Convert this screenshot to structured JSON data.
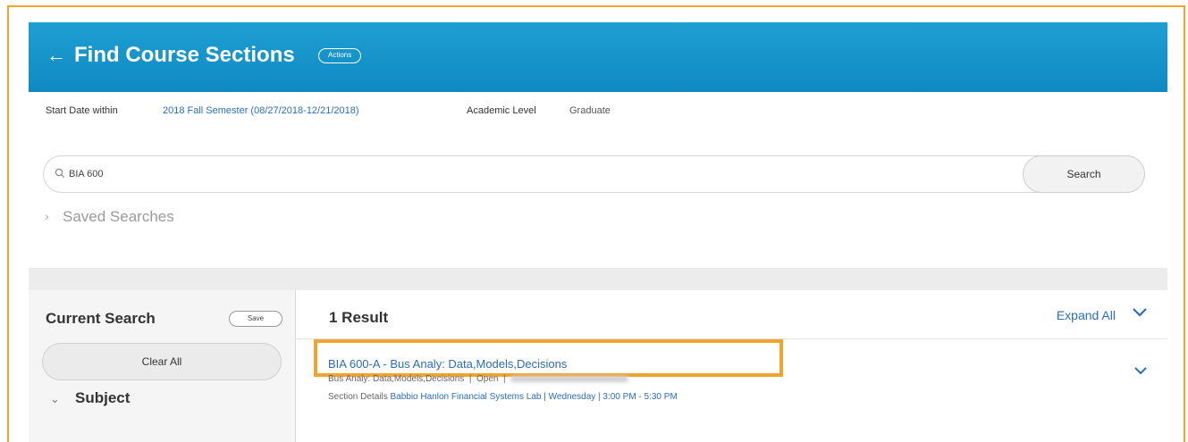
{
  "header": {
    "back_icon": "back-arrow-icon",
    "title": "Find Course Sections",
    "actions_label": "Actions"
  },
  "filters": {
    "start_date_label": "Start Date within",
    "start_date_value": "2018 Fall Semester (08/27/2018-12/21/2018)",
    "academic_level_label": "Academic Level",
    "academic_level_value": "Graduate"
  },
  "search": {
    "query": "BIA 600",
    "button_label": "Search",
    "saved_searches_label": "Saved Searches"
  },
  "sidebar": {
    "current_search_label": "Current Search",
    "save_label": "Save",
    "clear_all_label": "Clear All",
    "subject_label": "Subject"
  },
  "results": {
    "count_label": "1 Result",
    "expand_all_label": "Expand All",
    "items": [
      {
        "title": "BIA 600-A - Bus Analy: Data,Models,Decisions",
        "course_name": "Bus Analy: Data,Models,Decisions",
        "status": "Open",
        "details_label": "Section Details",
        "details_value": "Babbio Hanlon Financial Systems Lab | Wednesday | 3:00 PM - 5:30 PM"
      }
    ]
  },
  "colors": {
    "header_blue": "#1e9fd3",
    "link_blue": "#2a6ebb",
    "highlight_orange": "#f0a32e"
  }
}
